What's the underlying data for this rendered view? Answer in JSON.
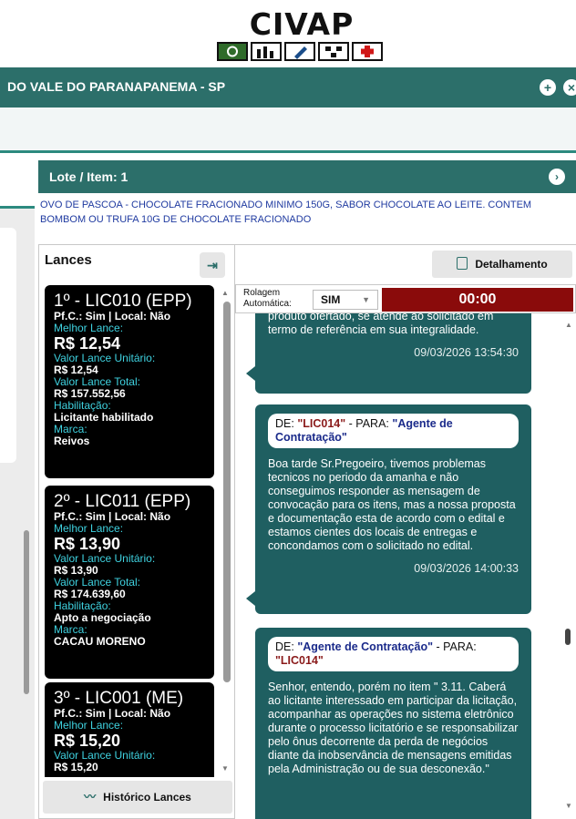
{
  "logo": {
    "text": "CIVAP",
    "icons": [
      "recycle-icon",
      "bar-chart-icon",
      "pencil-icon",
      "network-icon",
      "health-cross-icon"
    ]
  },
  "header": {
    "title": "DO VALE DO PARANAPANEMA - SP",
    "plus_icon": "+",
    "close_icon": "×"
  },
  "lote": {
    "title": "Lote / Item: 1",
    "description": "OVO DE PASCOA - CHOCOLATE FRACIONADO MINIMO 150G, SABOR CHOCOLATE AO LEITE. CONTEM BOMBOM OU TRUFA 10G DE CHOCOLATE FRACIONADO",
    "arrow_icon": "›"
  },
  "lances": {
    "title": "Lances",
    "exit_icon": "⇥",
    "bids": [
      {
        "header": "1º - LIC010 (EPP)",
        "pfc": "Pf.C.: Sim | Local: Não",
        "melhor_label": "Melhor Lance:",
        "melhor_value": "R$ 12,54",
        "unit_label": "Valor Lance Unitário:",
        "unit_value": "R$ 12,54",
        "total_label": "Valor Lance Total:",
        "total_value": "R$ 157.552,56",
        "hab_label": "Habilitação:",
        "hab_value": "Licitante habilitado",
        "marca_label": "Marca:",
        "marca_value": "Reivos"
      },
      {
        "header": "2º - LIC011 (EPP)",
        "pfc": "Pf.C.: Sim | Local: Não",
        "melhor_label": "Melhor Lance:",
        "melhor_value": "R$ 13,90",
        "unit_label": "Valor Lance Unitário:",
        "unit_value": "R$ 13,90",
        "total_label": "Valor Lance Total:",
        "total_value": "R$ 174.639,60",
        "hab_label": "Habilitação:",
        "hab_value": "Apto a negociação",
        "marca_label": "Marca:",
        "marca_value": "CACAU MORENO"
      },
      {
        "header": "3º - LIC001 (ME)",
        "pfc": "Pf.C.: Sim | Local: Não",
        "melhor_label": "Melhor Lance:",
        "melhor_value": "R$ 15,20",
        "unit_label": "Valor Lance Unitário:",
        "unit_value": "R$ 15,20"
      }
    ],
    "historico_label": "Histórico Lances",
    "historico_icon": "〰"
  },
  "chat": {
    "detalhamento_label": "Detalhamento",
    "rolagem_label": "Rolagem Automática:",
    "rolagem_value": "SIM",
    "timer": "00:00",
    "messages": [
      {
        "partial_text": "produto ofertado, se atende ao solicitado em termo de referência em sua integralidade.",
        "time": "09/03/2026 13:54:30"
      },
      {
        "de_label": "DE:",
        "from": "\"LIC014\"",
        "para_label": "- PARA:",
        "to": "\"Agente de Contratação\"",
        "text": "Boa tarde Sr.Pregoeiro, tivemos problemas tecnicos no periodo da amanha e não conseguimos responder as mensagem de convocação para os itens, mas a nossa proposta e documentação esta de acordo com o edital e estamos cientes dos locais de entregas e concondamos com o solicitado no edital.",
        "time": "09/03/2026 14:00:33"
      },
      {
        "de_label": "DE:",
        "from": "\"Agente de Contratação\"",
        "para_label": "- PARA:",
        "to": "\"LIC014\"",
        "text": "Senhor, entendo, porém no item \" 3.11. Caberá ao licitante interessado em participar da licitação, acompanhar as operações no sistema eletrônico durante o processo licitatório e se responsabilizar pelo ônus decorrente da perda de negócios diante da inobservância de mensagens emitidas pela Administração ou de sua desconexão.\""
      }
    ]
  },
  "colors": {
    "header_teal": "#2c6f6a",
    "message_teal": "#1f5f61",
    "timer_red": "#8a0b0b",
    "bid_label_cyan": "#3fd2e0"
  }
}
